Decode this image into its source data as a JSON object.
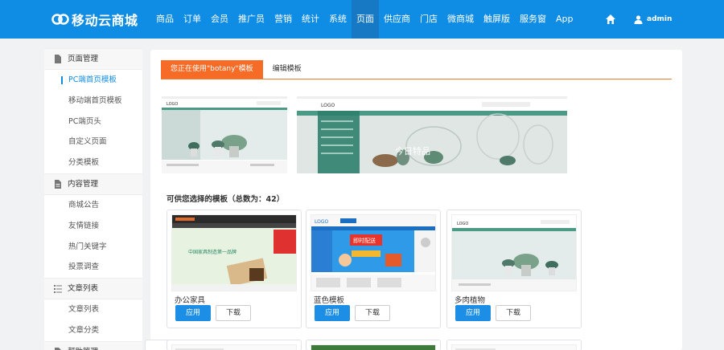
{
  "brand": {
    "name": "移动云商城",
    "logo_icon": "link-logo-icon"
  },
  "nav": {
    "items": [
      "商品",
      "订单",
      "会员",
      "推广员",
      "营销",
      "统计",
      "系统",
      "页面",
      "供应商",
      "门店",
      "微商城",
      "触屏版",
      "服务窗",
      "App"
    ],
    "active_index": 7
  },
  "header": {
    "home_icon": "home-icon",
    "user_icon": "user-icon",
    "username": "admin"
  },
  "sidebar": {
    "groups": [
      {
        "title": "页面管理",
        "icon": "page-icon",
        "items": [
          "PC端首页模板",
          "移动端首页模板",
          "PC端页头",
          "自定义页面",
          "分类模板"
        ]
      },
      {
        "title": "内容管理",
        "icon": "document-icon",
        "items": [
          "商城公告",
          "友情链接",
          "热门关键字",
          "投票调查"
        ]
      },
      {
        "title": "文章列表",
        "icon": "list-icon",
        "items": [
          "文章列表",
          "文章分类"
        ]
      },
      {
        "title": "帮助管理",
        "icon": "help-icon",
        "items": []
      }
    ],
    "active_item": "PC端首页模板"
  },
  "tabs": {
    "active_label": "您正在使用\"botany\"模板",
    "other_label": "编辑模板"
  },
  "current_template": {
    "logo_text": "LOGO",
    "banner_text": "今日特品"
  },
  "section_title": "可供您选择的模板（总数为：42）",
  "templates": [
    {
      "name": "办公家具",
      "apply_label": "应用",
      "download_label": "下载",
      "thumb_text": "中国家具制造第一品牌"
    },
    {
      "name": "蓝色模板",
      "apply_label": "应用",
      "download_label": "下载",
      "thumb_text": "即时配送"
    },
    {
      "name": "多肉植物",
      "apply_label": "应用",
      "download_label": "下载",
      "thumb_text": "LOGO"
    }
  ],
  "colors": {
    "topbar": "#0f8ce4",
    "active_tab": "#f66b26",
    "apply_button": "#1d8ee6"
  }
}
